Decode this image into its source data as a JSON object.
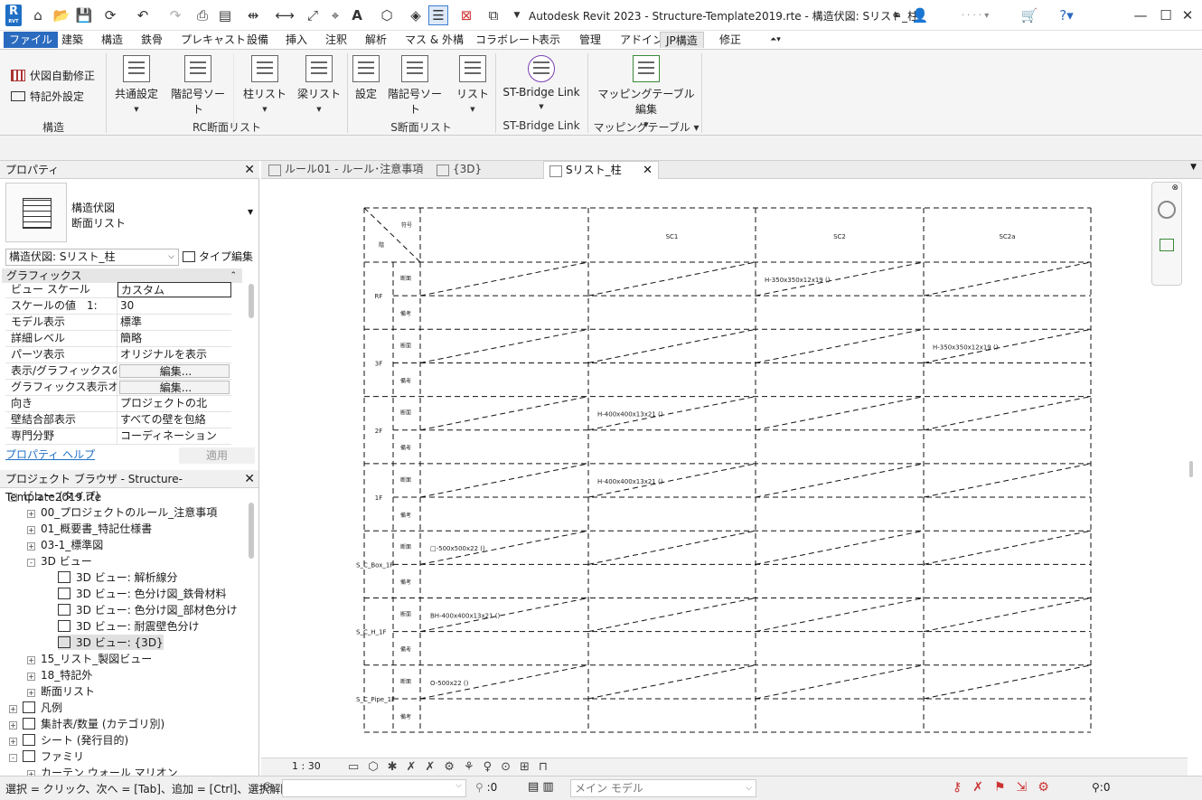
{
  "titlebar": {
    "app_title": "Autodesk Revit 2023 - Structure-Template2019.rte - 構造伏図: Sリスト_柱",
    "logo_text": "R",
    "logo_sub": "RVT"
  },
  "menu": {
    "tabs": [
      "ファイル",
      "建築",
      "構造",
      "鉄骨",
      "プレキャスト",
      "設備",
      "挿入",
      "注釈",
      "解析",
      "マス & 外構",
      "コラボレート",
      "表示",
      "管理",
      "アドイン",
      "JP構造",
      "修正"
    ],
    "active": "JP構造"
  },
  "ribbon": {
    "structure_panel": {
      "btn1": "伏図自動修正",
      "btn2": "特記外設定",
      "label": "構造"
    },
    "rc_panel": {
      "btn1": "共通設定",
      "btn2": "階記号ソート",
      "btn3": "柱リスト",
      "btn4": "梁リスト",
      "label": "RC断面リスト"
    },
    "s_panel": {
      "btn1": "設定",
      "btn2": "階記号ソート",
      "btn3": "リスト",
      "label": "S断面リスト"
    },
    "stb_panel": {
      "btn1": "ST-Bridge Link",
      "label": "ST-Bridge Link"
    },
    "map_panel": {
      "btn1": "マッピングテーブル編集",
      "label": "マッピングテーブル"
    }
  },
  "properties": {
    "title": "プロパティ",
    "type_name_1": "構造伏図",
    "type_name_2": "断面リスト",
    "selector": "構造伏図: Sリスト_柱",
    "edit_type": "タイプ編集",
    "group": "グラフィックス",
    "rows": [
      {
        "k": "ビュー スケール",
        "v": "カスタム"
      },
      {
        "k": "スケールの値　1:",
        "v": "30"
      },
      {
        "k": "モデル表示",
        "v": "標準"
      },
      {
        "k": "詳細レベル",
        "v": "簡略"
      },
      {
        "k": "パーツ表示",
        "v": "オリジナルを表示"
      },
      {
        "k": "表示/グラフィックスの...",
        "v": "編集..."
      },
      {
        "k": "グラフィックス表示オプ...",
        "v": "編集..."
      },
      {
        "k": "向き",
        "v": "プロジェクトの北"
      },
      {
        "k": "壁結合部表示",
        "v": "すべての壁を包絡"
      },
      {
        "k": "専門分野",
        "v": "コーディネーション"
      }
    ],
    "help": "プロパティ ヘルプ",
    "apply": "適用"
  },
  "browser": {
    "title": "プロジェクト ブラウザ - Structure-Template2019.rte",
    "items": [
      {
        "label": "ビュー (タイプ)",
        "pm": "-"
      },
      {
        "label": "00_プロジェクトのルール_注意事項",
        "pm": "+"
      },
      {
        "label": "01_概要書_特記仕様書",
        "pm": "+"
      },
      {
        "label": "03-1_標準図",
        "pm": "+"
      },
      {
        "label": "3D ビュー",
        "pm": "-"
      },
      {
        "label": "3D ビュー: 解析線分"
      },
      {
        "label": "3D ビュー: 色分け図_鉄骨材料"
      },
      {
        "label": "3D ビュー: 色分け図_部材色分け"
      },
      {
        "label": "3D ビュー: 耐震壁色分け"
      },
      {
        "label": "3D ビュー: {3D}"
      },
      {
        "label": "15_リスト_製図ビュー",
        "pm": "+"
      },
      {
        "label": "18_特記外",
        "pm": "+"
      },
      {
        "label": "断面リスト",
        "pm": "+"
      },
      {
        "label": "凡例",
        "pm": "+"
      },
      {
        "label": "集計表/数量 (カテゴリ別)",
        "pm": "+"
      },
      {
        "label": "シート (発行目的)",
        "pm": "+"
      },
      {
        "label": "ファミリ",
        "pm": "-"
      },
      {
        "label": "カーテン ウォール マリオン",
        "pm": "+"
      }
    ]
  },
  "viewtabs": [
    {
      "label": "ルール01 - ルール･注意事項"
    },
    {
      "label": "{3D}"
    },
    {
      "label": "Sリスト_柱",
      "active": true
    }
  ],
  "drawing": {
    "header_symbol": "符号",
    "header_floor": "階",
    "columns": [
      "SC1",
      "SC2",
      "SC2a"
    ],
    "row_sub_top": "断面",
    "row_sub_bottom": "備考",
    "floors": [
      "RF",
      "3F",
      "2F",
      "1F",
      "S_C_Box_1F",
      "S_C_H_1F",
      "S_C_Pipe_1F"
    ],
    "annotations": [
      {
        "row": 0,
        "col": 1,
        "text": "H-350x350x12x19 ()"
      },
      {
        "row": 1,
        "col": 2,
        "text": "H-350x350x12x19 ()"
      },
      {
        "row": 2,
        "col": 0,
        "text": "H-400x400x13x21 ()"
      },
      {
        "row": 3,
        "col": 0,
        "text": "H-400x400x13x21 ()"
      },
      {
        "row": 4,
        "col": -1,
        "text": "□-500x500x22 ()"
      },
      {
        "row": 5,
        "col": -1,
        "text": "BH-400x400x13x21 ()"
      },
      {
        "row": 6,
        "col": -1,
        "text": "O-500x22 ()"
      }
    ]
  },
  "viewctrl": {
    "scale": "1 : 30"
  },
  "status": {
    "message": "選択 = クリック、次へ = [Tab]、追加 = [Ctrl]、選択解除 = ",
    "count1": ":0",
    "model": "メイン モデル",
    "count2": ":0"
  }
}
